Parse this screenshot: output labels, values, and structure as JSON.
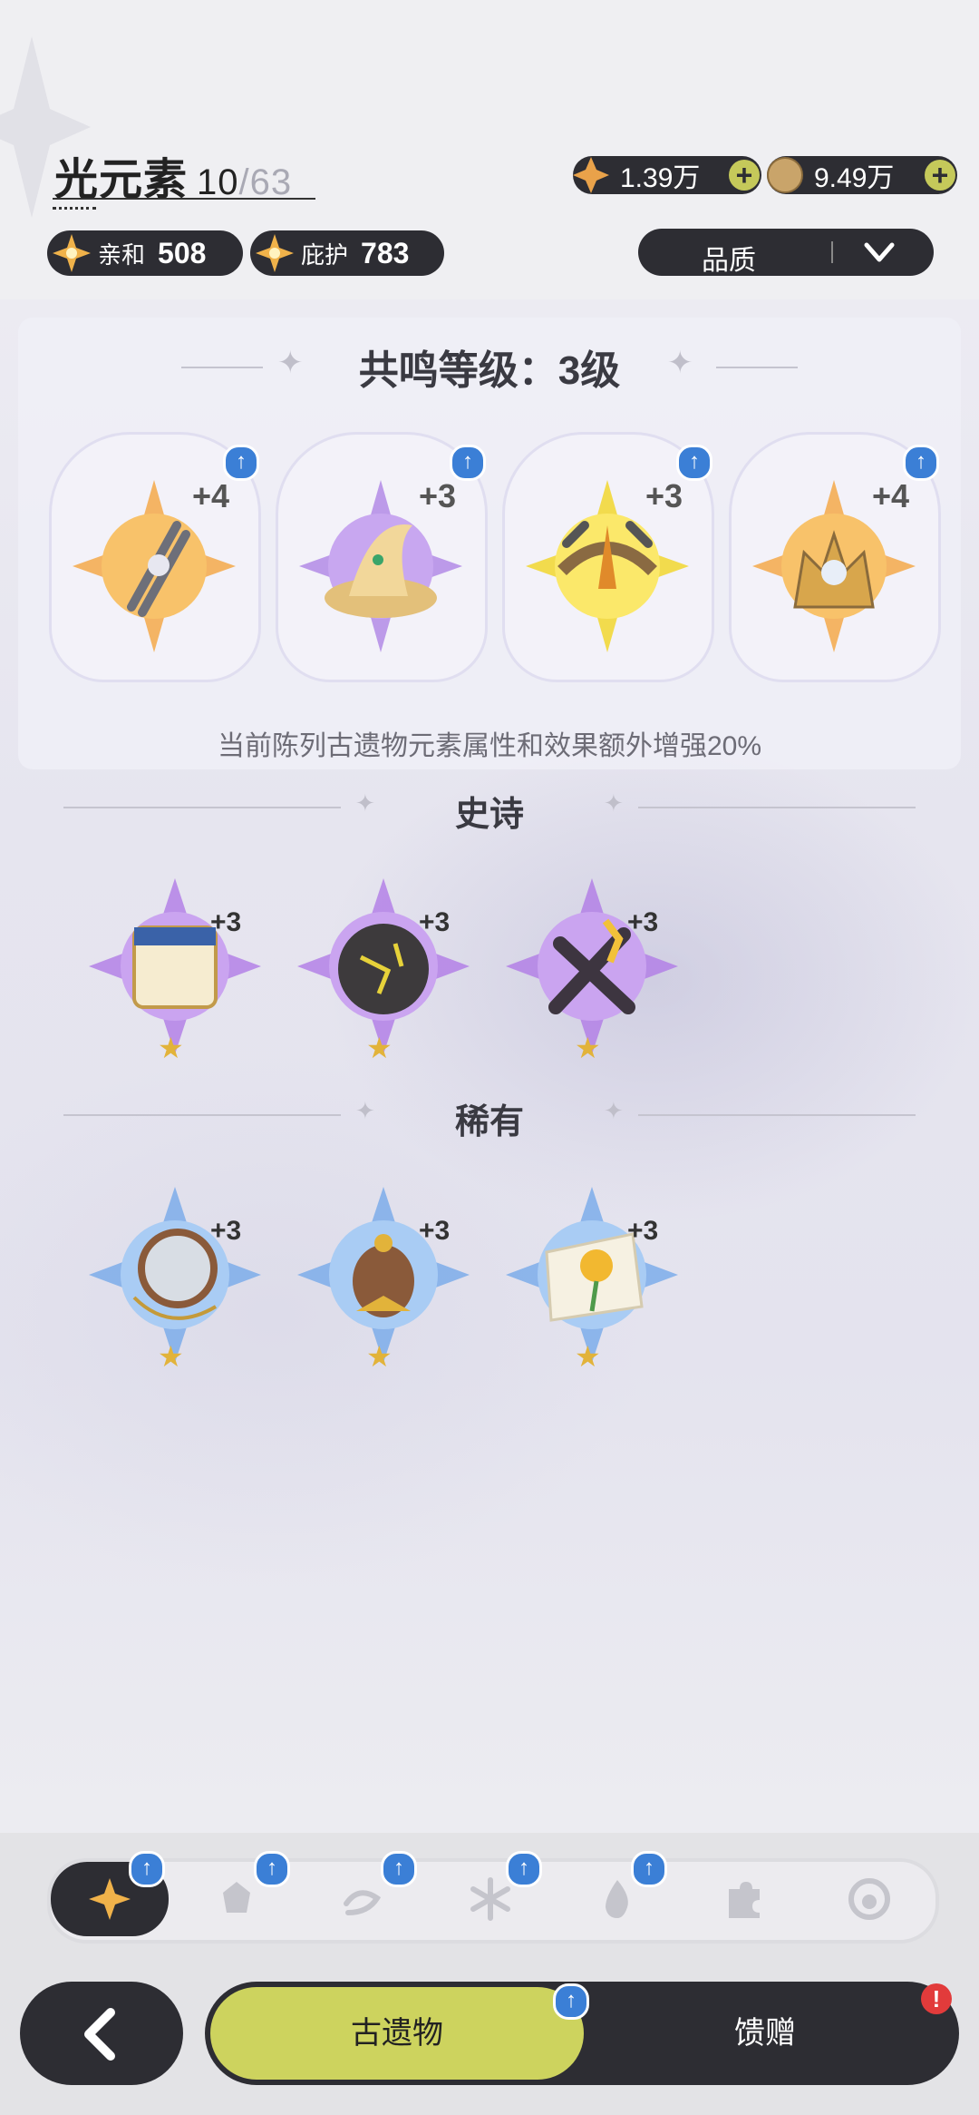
{
  "header": {
    "title": "光元素",
    "count": "10",
    "total": "/63",
    "stats": [
      {
        "label": "亲和",
        "value": "508"
      },
      {
        "label": "庇护",
        "value": "783"
      }
    ],
    "currency": [
      {
        "icon": "crystal-icon",
        "value": "1.39万"
      },
      {
        "icon": "coin-icon",
        "value": "9.49万"
      }
    ],
    "filter_label": "品质"
  },
  "resonance": {
    "title": "共鸣等级：3级",
    "bonus_text": "当前陈列古遗物元素属性和效果额外增强20%",
    "slots": [
      {
        "name": "sword-relic-icon",
        "level": "+4",
        "glow": "#f3a94a"
      },
      {
        "name": "hat-relic-icon",
        "level": "+3",
        "glow": "#b28be6"
      },
      {
        "name": "crossbow-relic-icon",
        "level": "+3",
        "glow": "#f2d83a"
      },
      {
        "name": "crown-relic-icon",
        "level": "+4",
        "glow": "#f3a94a"
      }
    ]
  },
  "sections": [
    {
      "title": "史诗",
      "color": "#b07be6",
      "items": [
        {
          "name": "scroll-relic-icon",
          "level": "+3",
          "star": "★"
        },
        {
          "name": "stone-relic-icon",
          "level": "+3",
          "star": "★"
        },
        {
          "name": "bow-relic-icon",
          "level": "+3",
          "star": "★"
        }
      ]
    },
    {
      "title": "稀有",
      "color": "#6fa6ea",
      "items": [
        {
          "name": "mirror-relic-icon",
          "level": "+3",
          "star": "★"
        },
        {
          "name": "egg-relic-icon",
          "level": "+3",
          "star": "★"
        },
        {
          "name": "flower-painting-relic-icon",
          "level": "+3",
          "star": "★"
        }
      ]
    }
  ],
  "element_tabs": [
    {
      "name": "light-element-tab",
      "active": true,
      "upgrade": true
    },
    {
      "name": "shadow-element-tab",
      "upgrade": true
    },
    {
      "name": "wind-element-tab",
      "upgrade": true
    },
    {
      "name": "ice-element-tab",
      "upgrade": true
    },
    {
      "name": "fire-element-tab",
      "upgrade": true
    },
    {
      "name": "puzzle-element-tab",
      "upgrade": false
    },
    {
      "name": "locked-element-tab",
      "upgrade": false
    }
  ],
  "bottom_nav": {
    "active": "古遗物",
    "other": "馈赠",
    "alert": "!"
  }
}
